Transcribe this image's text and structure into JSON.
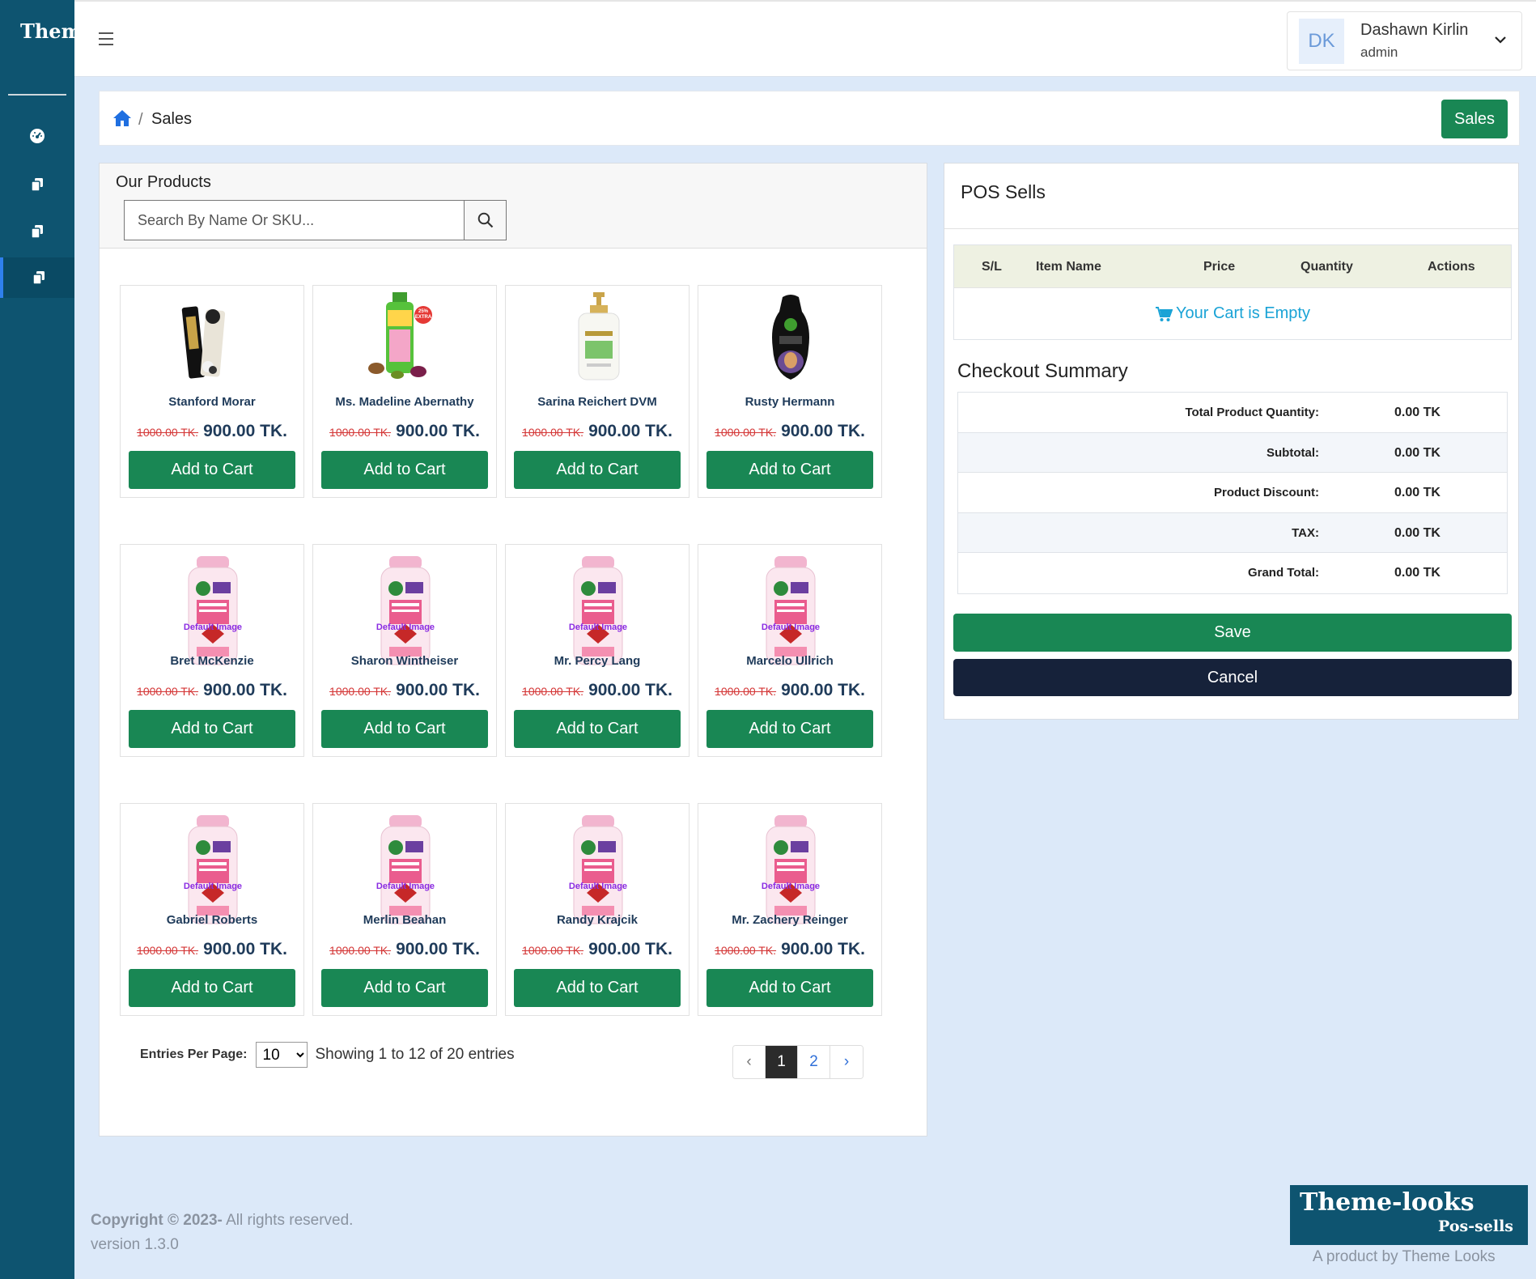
{
  "brand": {
    "name": "Theme-looks"
  },
  "header": {
    "user": {
      "initials": "DK",
      "name": "Dashawn Kirlin",
      "role": "admin"
    }
  },
  "breadcrumb": {
    "separator": "/",
    "current": "Sales",
    "button_label": "Sales"
  },
  "products": {
    "title": "Our Products",
    "search_placeholder": "Search By Name Or SKU...",
    "add_label": "Add to Cart",
    "image_overlay": "Default Image",
    "items": [
      {
        "name": "Stanford Morar",
        "old_price": "1000.00 TK.",
        "price": "900.00 TK.",
        "image": "black-tube-product"
      },
      {
        "name": "Ms. Madeline Abernathy",
        "old_price": "1000.00 TK.",
        "price": "900.00 TK.",
        "image": "green-oil-bottle",
        "badge": "25% EXTRA"
      },
      {
        "name": "Sarina Reichert DVM",
        "old_price": "1000.00 TK.",
        "price": "900.00 TK.",
        "image": "white-shampoo-pump"
      },
      {
        "name": "Rusty Hermann",
        "old_price": "1000.00 TK.",
        "price": "900.00 TK.",
        "image": "black-shampoo-bottle"
      },
      {
        "name": "Bret McKenzie",
        "old_price": "1000.00 TK.",
        "price": "900.00 TK.",
        "image": "default-bodywash"
      },
      {
        "name": "Sharon Wintheiser",
        "old_price": "1000.00 TK.",
        "price": "900.00 TK.",
        "image": "default-bodywash"
      },
      {
        "name": "Mr. Percy Lang",
        "old_price": "1000.00 TK.",
        "price": "900.00 TK.",
        "image": "default-bodywash"
      },
      {
        "name": "Marcelo Ullrich",
        "old_price": "1000.00 TK.",
        "price": "900.00 TK.",
        "image": "default-bodywash"
      },
      {
        "name": "Gabriel Roberts",
        "old_price": "1000.00 TK.",
        "price": "900.00 TK.",
        "image": "default-bodywash"
      },
      {
        "name": "Merlin Beahan",
        "old_price": "1000.00 TK.",
        "price": "900.00 TK.",
        "image": "default-bodywash"
      },
      {
        "name": "Randy Krajcik",
        "old_price": "1000.00 TK.",
        "price": "900.00 TK.",
        "image": "default-bodywash"
      },
      {
        "name": "Mr. Zachery Reinger",
        "old_price": "1000.00 TK.",
        "price": "900.00 TK.",
        "image": "default-bodywash"
      }
    ]
  },
  "pagination": {
    "entries_label": "Entries Per Page:",
    "entries_value": "10",
    "showing": "Showing 1 to 12 of 20 entries",
    "prev": "‹",
    "pages": [
      "1",
      "2"
    ],
    "current_page": "1",
    "next": "›"
  },
  "pos": {
    "title": "POS Sells",
    "columns": [
      "S/L",
      "Item Name",
      "Price",
      "Quantity",
      "Actions"
    ],
    "empty_text": "Your Cart is Empty",
    "checkout_title": "Checkout Summary",
    "summary": [
      {
        "label": "Total Product Quantity:",
        "value": "0.00 TK"
      },
      {
        "label": "Subtotal:",
        "value": "0.00 TK"
      },
      {
        "label": "Product Discount:",
        "value": "0.00 TK"
      },
      {
        "label": "TAX:",
        "value": "0.00 TK"
      },
      {
        "label": "Grand Total:",
        "value": "0.00 TK"
      }
    ],
    "save_label": "Save",
    "cancel_label": "Cancel"
  },
  "footer": {
    "copyright_bold": "Copyright © 2023-",
    "copyright_rest": " All rights reserved.",
    "version": "version 1.3.0",
    "logo_main": "Theme-looks",
    "logo_sub": "Pos-sells",
    "tagline": "A product by Theme Looks"
  },
  "colors": {
    "sidebar": "#0e5470",
    "primary_green": "#198754",
    "cancel_dark": "#16223a",
    "page_bg": "#dce9f9",
    "price_text": "#1f3b5a",
    "old_price": "#d43737",
    "empty_cart": "#1aa3d6"
  },
  "icons": {
    "sidebar": [
      "dashboard-icon",
      "copy-icon",
      "copy-icon",
      "copy-icon"
    ],
    "header": [
      "hamburger-icon",
      "chevron-down-icon"
    ],
    "breadcrumb": "home-icon",
    "search": "search-icon",
    "cart": "cart-icon"
  }
}
